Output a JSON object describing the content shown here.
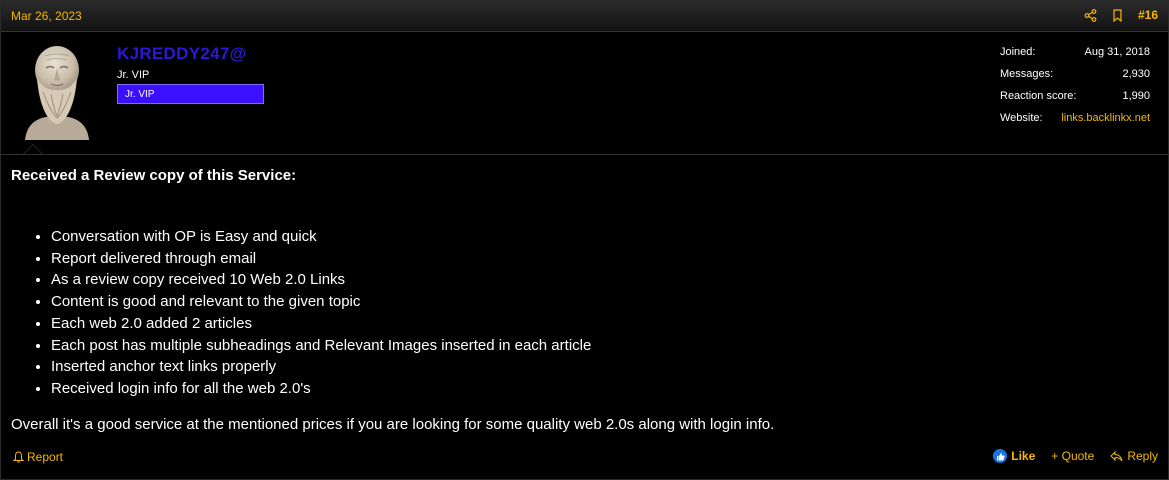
{
  "header": {
    "date": "Mar 26, 2023",
    "post_number": "#16"
  },
  "user": {
    "username": "KJREDDY247@",
    "title": "Jr. VIP",
    "banner": "Jr. VIP",
    "stats": [
      {
        "label": "Joined:",
        "value": "Aug 31, 2018"
      },
      {
        "label": "Messages:",
        "value": "2,930"
      },
      {
        "label": "Reaction score:",
        "value": "1,990"
      }
    ],
    "website": {
      "label": "Website:",
      "value": "links.backlinkx.net"
    }
  },
  "post": {
    "heading": "Received a Review copy of this Service:",
    "items": [
      "Conversation with OP is Easy and quick",
      "Report delivered through email",
      "As a review copy received 10 Web 2.0 Links",
      "Content is good and relevant to the given topic",
      "Each web 2.0 added 2 articles",
      "Each post has multiple subheadings and Relevant Images inserted in each article",
      "Inserted anchor text links properly",
      "Received login info for all the web 2.0's"
    ],
    "summary": "Overall it's a good service at the mentioned prices if you are looking for some quality web 2.0s along with login info."
  },
  "footer": {
    "report_label": "Report",
    "like_label": "Like",
    "quote_label": "+ Quote",
    "reply_label": "Reply"
  },
  "colors": {
    "accent": "#f5b800",
    "username": "#2b18d8",
    "banner": "#3b10ff",
    "like_badge": "#1b74e4"
  },
  "icons": [
    "share-icon",
    "bookmark-icon",
    "bell-icon",
    "like-icon",
    "reply-icon"
  ]
}
